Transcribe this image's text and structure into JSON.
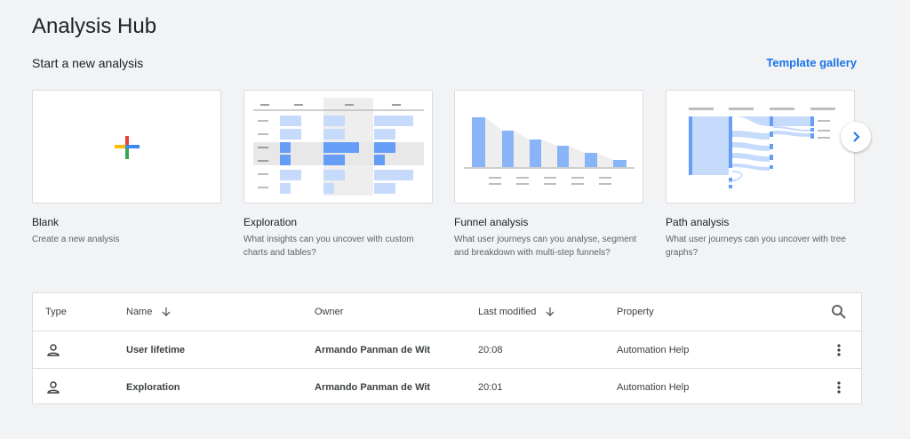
{
  "header": {
    "title": "Analysis Hub"
  },
  "new_analysis": {
    "section_title": "Start a new analysis",
    "template_gallery": "Template gallery",
    "cards": [
      {
        "title": "Blank",
        "desc": "Create a new analysis",
        "icon": "plus-icon"
      },
      {
        "title": "Exploration",
        "desc": "What insights can you uncover with custom charts and tables?",
        "icon": "exploration-thumbnail"
      },
      {
        "title": "Funnel analysis",
        "desc": "What user journeys can you analyse, segment and breakdown with multi-step funnels?",
        "icon": "funnel-thumbnail"
      },
      {
        "title": "Path analysis",
        "desc": "What user journeys can you uncover with tree graphs?",
        "icon": "path-thumbnail"
      }
    ],
    "next_icon": "chevron-right-icon"
  },
  "table": {
    "headers": {
      "type": "Type",
      "name": "Name",
      "owner": "Owner",
      "last_modified": "Last modified",
      "property": "Property"
    },
    "rows": [
      {
        "type_icon": "person-icon",
        "name": "User lifetime",
        "owner": "Armando Panman de Wit",
        "last_modified": "20:08",
        "property": "Automation Help"
      },
      {
        "type_icon": "person-icon",
        "name": "Exploration",
        "owner": "Armando Panman de Wit",
        "last_modified": "20:01",
        "property": "Automation Help"
      }
    ]
  },
  "colors": {
    "accent": "#1a73e8",
    "bar_blue": "#8ab4f8",
    "bar_blue_dark": "#669df6",
    "google_blue": "#4285f4",
    "google_red": "#ea4335",
    "google_yellow": "#fbbc04",
    "google_green": "#34a853"
  }
}
